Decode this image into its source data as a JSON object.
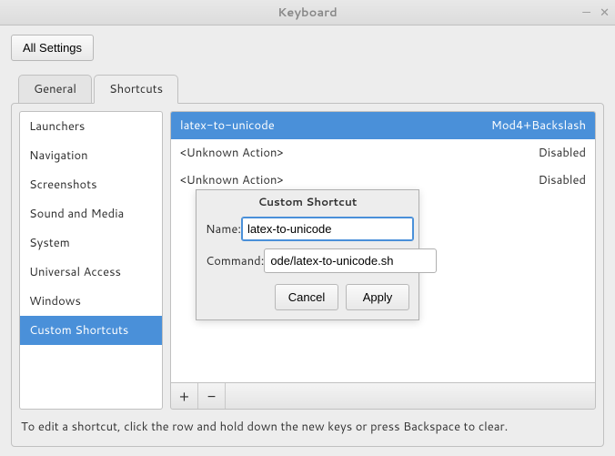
{
  "window": {
    "title": "Keyboard"
  },
  "toolbar": {
    "all_settings": "All Settings"
  },
  "tabs": {
    "general": "General",
    "shortcuts": "Shortcuts"
  },
  "categories": [
    "Launchers",
    "Navigation",
    "Screenshots",
    "Sound and Media",
    "System",
    "Universal Access",
    "Windows",
    "Custom Shortcuts"
  ],
  "selected_category_index": 7,
  "shortcuts": [
    {
      "name": "latex-to-unicode",
      "accel": "Mod4+Backslash",
      "selected": true
    },
    {
      "name": "<Unknown Action>",
      "accel": "Disabled",
      "selected": false
    },
    {
      "name": "<Unknown Action>",
      "accel": "Disabled",
      "selected": false
    }
  ],
  "toolbar_icons": {
    "add": "+",
    "remove": "−"
  },
  "hint": "To edit a shortcut, click the row and hold down the new keys or press Backspace to clear.",
  "dialog": {
    "title": "Custom Shortcut",
    "name_label": "Name:",
    "name_value": "latex-to-unicode",
    "command_label": "Command:",
    "command_value": "ode/latex-to-unicode.sh",
    "cancel": "Cancel",
    "apply": "Apply"
  }
}
